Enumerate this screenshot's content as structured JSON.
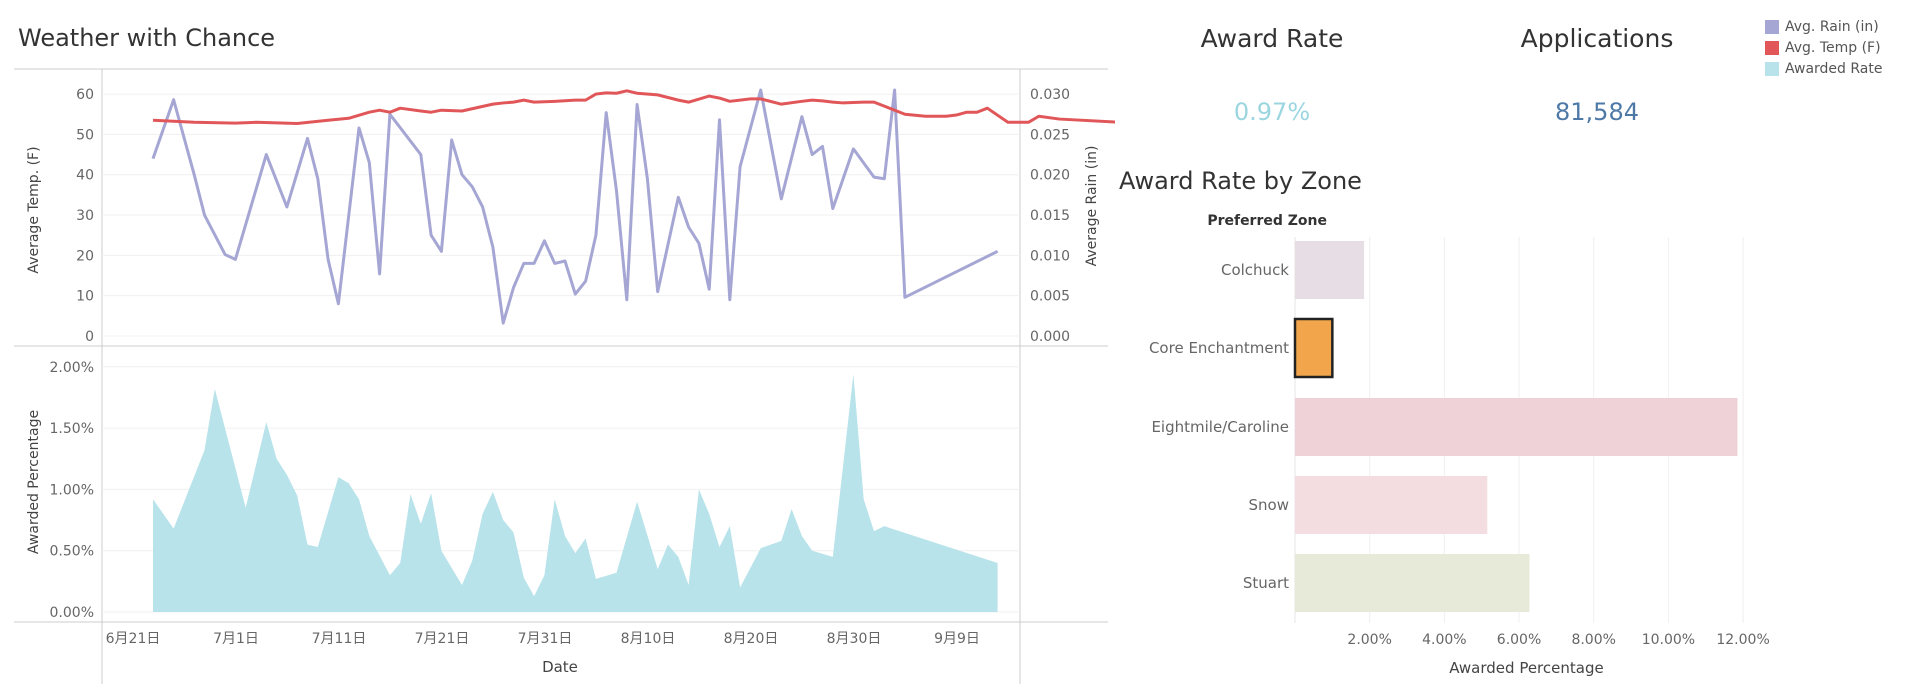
{
  "colors": {
    "rain": "#a5a6d4",
    "temp": "#e15759",
    "awarded": "#b8e3ea",
    "award_rate_value": "#9bd6e0",
    "applications_value": "#4e79a7"
  },
  "legend": [
    {
      "label": "Avg. Rain (in)",
      "color": "#a5a6d4"
    },
    {
      "label": "Avg. Temp (F)",
      "color": "#e15759"
    },
    {
      "label": "Awarded Rate",
      "color": "#b8e3ea"
    }
  ],
  "kpis": {
    "award_rate": {
      "title": "Award Rate",
      "value": "0.97%"
    },
    "applications": {
      "title": "Applications",
      "value": "81,584"
    }
  },
  "chart_data": [
    {
      "type": "line",
      "title": "Weather with Chance",
      "xlabel": "Date",
      "x_tick_labels": [
        "6月21日",
        "7月1日",
        "7月11日",
        "7月21日",
        "7月31日",
        "8月10日",
        "8月20日",
        "8月30日",
        "9月9日"
      ],
      "x_start": "6月21日",
      "x_end": "9月17日",
      "ylabel": "Average Temp. (F)",
      "ylim": [
        0,
        62
      ],
      "y_ticks": [
        "60",
        "50",
        "40",
        "30",
        "20",
        "10",
        "0"
      ],
      "y2label": "Average Rain (in)",
      "y2lim": [
        0,
        0.031
      ],
      "y2_ticks": [
        "0.030",
        "0.025",
        "0.020",
        "0.015",
        "0.010",
        "0.005",
        "0.000"
      ],
      "series": [
        {
          "name": "Avg. Temp (F)",
          "axis": "left",
          "points": [
            [
              1,
              53.5
            ],
            [
              5,
              53
            ],
            [
              9,
              52.8
            ],
            [
              11,
              53
            ],
            [
              15,
              52.7
            ],
            [
              18,
              53.5
            ],
            [
              20,
              54
            ],
            [
              22,
              55.5
            ],
            [
              23,
              56
            ],
            [
              24,
              55.5
            ],
            [
              25,
              56.5
            ],
            [
              27,
              55.8
            ],
            [
              28,
              55.5
            ],
            [
              29,
              56
            ],
            [
              31,
              55.8
            ],
            [
              34,
              57.5
            ],
            [
              35,
              57.8
            ],
            [
              36,
              58
            ],
            [
              37,
              58.5
            ],
            [
              38,
              58
            ],
            [
              40,
              58.2
            ],
            [
              42,
              58.5
            ],
            [
              43,
              58.5
            ],
            [
              44,
              60
            ],
            [
              45,
              60.3
            ],
            [
              46,
              60.2
            ],
            [
              47,
              60.8
            ],
            [
              48,
              60.2
            ],
            [
              50,
              59.8
            ],
            [
              52,
              58.5
            ],
            [
              53,
              58
            ],
            [
              55,
              59.5
            ],
            [
              56,
              59
            ],
            [
              57,
              58.2
            ],
            [
              58,
              58.5
            ],
            [
              59,
              58.8
            ],
            [
              60,
              58.8
            ],
            [
              62,
              57.5
            ],
            [
              64,
              58.2
            ],
            [
              65,
              58.5
            ],
            [
              66,
              58.3
            ],
            [
              67,
              58
            ],
            [
              68,
              57.8
            ],
            [
              70,
              58
            ],
            [
              71,
              58
            ],
            [
              72,
              57
            ],
            [
              74,
              55
            ],
            [
              76,
              54.5
            ],
            [
              78,
              54.5
            ],
            [
              79,
              54.8
            ],
            [
              80,
              55.5
            ],
            [
              81,
              55.5
            ],
            [
              82,
              56.5
            ],
            [
              84,
              53
            ],
            [
              86,
              53
            ],
            [
              87,
              54.5
            ],
            [
              89,
              53.8
            ],
            [
              95,
              53
            ],
            [
              100,
              52.3
            ]
          ]
        },
        {
          "name": "Avg. Rain (in)",
          "axis": "right",
          "points": [
            [
              1,
              0.022
            ],
            [
              3,
              0.0293
            ],
            [
              5,
              0.02
            ],
            [
              6,
              0.015
            ],
            [
              8,
              0.0101
            ],
            [
              9,
              0.0095
            ],
            [
              12,
              0.0225
            ],
            [
              14,
              0.016
            ],
            [
              16,
              0.0245
            ],
            [
              17,
              0.0195
            ],
            [
              18,
              0.0095
            ],
            [
              19,
              0.004
            ],
            [
              21,
              0.0258
            ],
            [
              22,
              0.0215
            ],
            [
              23,
              0.0077
            ],
            [
              24,
              0.0275
            ],
            [
              27,
              0.0225
            ],
            [
              28,
              0.0125
            ],
            [
              29,
              0.0105
            ],
            [
              30,
              0.0243
            ],
            [
              31,
              0.02
            ],
            [
              32,
              0.0185
            ],
            [
              33,
              0.016
            ],
            [
              34,
              0.011
            ],
            [
              35,
              0.0016
            ],
            [
              36,
              0.006
            ],
            [
              37,
              0.009
            ],
            [
              38,
              0.009
            ],
            [
              39,
              0.0118
            ],
            [
              40,
              0.009
            ],
            [
              41,
              0.0093
            ],
            [
              42,
              0.0052
            ],
            [
              43,
              0.0068
            ],
            [
              44,
              0.0125
            ],
            [
              45,
              0.0277
            ],
            [
              46,
              0.018
            ],
            [
              47,
              0.0045
            ],
            [
              48,
              0.0287
            ],
            [
              49,
              0.0195
            ],
            [
              50,
              0.0055
            ],
            [
              52,
              0.0172
            ],
            [
              53,
              0.0135
            ],
            [
              54,
              0.0115
            ],
            [
              55,
              0.0058
            ],
            [
              56,
              0.0268
            ],
            [
              57,
              0.0045
            ],
            [
              58,
              0.021
            ],
            [
              60,
              0.0305
            ],
            [
              62,
              0.017
            ],
            [
              64,
              0.0272
            ],
            [
              65,
              0.0225
            ],
            [
              66,
              0.0235
            ],
            [
              67,
              0.0158
            ],
            [
              69,
              0.0232
            ],
            [
              71,
              0.0197
            ],
            [
              72,
              0.0195
            ],
            [
              73,
              0.0305
            ],
            [
              74,
              0.0048
            ],
            [
              83,
              0.0105
            ]
          ]
        }
      ]
    },
    {
      "type": "area",
      "series_name": "Awarded Rate",
      "ylabel": "Awarded Percentage",
      "ylim": [
        0,
        2.08
      ],
      "y_ticks": [
        "2.00%",
        "1.50%",
        "1.00%",
        "0.50%",
        "0.00%"
      ],
      "points": [
        [
          1,
          0.92
        ],
        [
          3,
          0.68
        ],
        [
          6,
          1.32
        ],
        [
          7,
          1.82
        ],
        [
          10,
          0.85
        ],
        [
          12,
          1.55
        ],
        [
          13,
          1.25
        ],
        [
          14,
          1.12
        ],
        [
          15,
          0.95
        ],
        [
          16,
          0.55
        ],
        [
          17,
          0.53
        ],
        [
          19,
          1.1
        ],
        [
          20,
          1.05
        ],
        [
          21,
          0.92
        ],
        [
          22,
          0.62
        ],
        [
          24,
          0.3
        ],
        [
          25,
          0.4
        ],
        [
          26,
          0.96
        ],
        [
          27,
          0.72
        ],
        [
          28,
          0.97
        ],
        [
          29,
          0.5
        ],
        [
          31,
          0.22
        ],
        [
          32,
          0.42
        ],
        [
          33,
          0.8
        ],
        [
          34,
          0.98
        ],
        [
          35,
          0.75
        ],
        [
          36,
          0.65
        ],
        [
          37,
          0.28
        ],
        [
          38,
          0.13
        ],
        [
          39,
          0.3
        ],
        [
          40,
          0.92
        ],
        [
          41,
          0.62
        ],
        [
          42,
          0.48
        ],
        [
          43,
          0.6
        ],
        [
          44,
          0.27
        ],
        [
          46,
          0.32
        ],
        [
          48,
          0.9
        ],
        [
          50,
          0.35
        ],
        [
          51,
          0.55
        ],
        [
          52,
          0.45
        ],
        [
          53,
          0.22
        ],
        [
          54,
          1.0
        ],
        [
          55,
          0.8
        ],
        [
          56,
          0.53
        ],
        [
          57,
          0.7
        ],
        [
          58,
          0.2
        ],
        [
          60,
          0.52
        ],
        [
          62,
          0.58
        ],
        [
          63,
          0.84
        ],
        [
          64,
          0.62
        ],
        [
          65,
          0.5
        ],
        [
          67,
          0.45
        ],
        [
          69,
          1.94
        ],
        [
          70,
          0.92
        ],
        [
          71,
          0.66
        ],
        [
          72,
          0.7
        ],
        [
          83,
          0.4
        ]
      ]
    },
    {
      "type": "bar",
      "orientation": "horizontal",
      "title": "Award Rate by Zone",
      "category_header": "Preferred Zone",
      "xlabel": "Awarded Percentage",
      "xlim": [
        0,
        12.4
      ],
      "x_ticks": [
        "2.00%",
        "4.00%",
        "6.00%",
        "8.00%",
        "10.00%",
        "12.00%"
      ],
      "categories": [
        "Colchuck",
        "Core Enchantment",
        "Eightmile/Caroline",
        "Snow",
        "Stuart"
      ],
      "values": [
        1.85,
        1.0,
        11.85,
        5.15,
        6.28
      ],
      "bar_colors": [
        "#e6dde5",
        "#f2a54a",
        "#eed2d8",
        "#f3dde0",
        "#e7ead9"
      ],
      "highlighted": "Core Enchantment"
    }
  ]
}
